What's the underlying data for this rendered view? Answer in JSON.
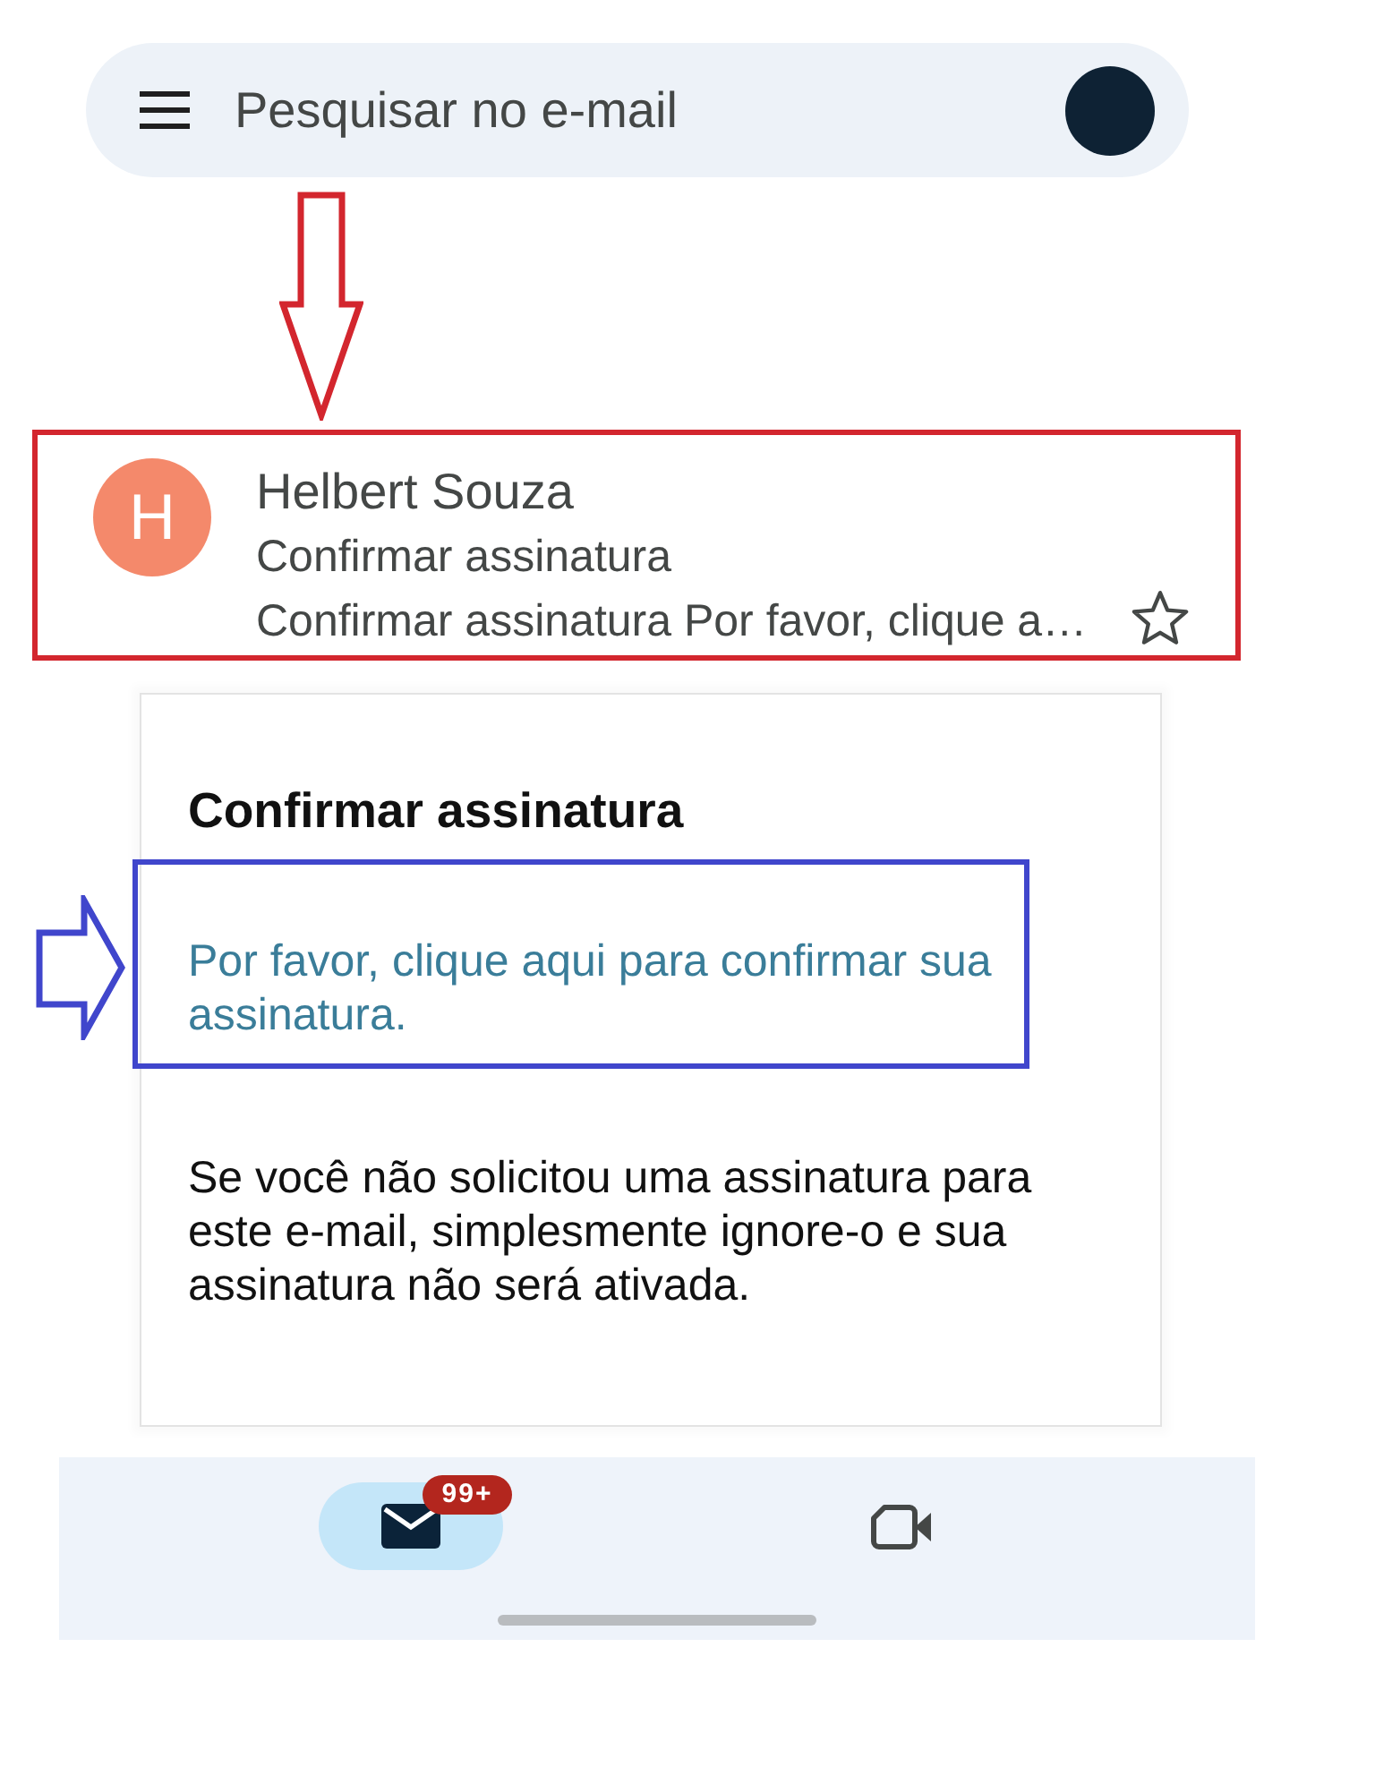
{
  "search_bar": {
    "placeholder": "Pesquisar no e-mail"
  },
  "email_row": {
    "avatar_letter": "H",
    "sender": "Helbert Souza",
    "subject": "Confirmar assinatura",
    "snippet": "Confirmar assinatura Por favor, clique a…",
    "starred": false,
    "highlight": {
      "kind": "down",
      "color": "#d3262e"
    }
  },
  "email_body": {
    "title": "Confirmar assinatura",
    "link": {
      "text": "Por favor, clique aqui para confirmar sua assinatura.",
      "highlight": {
        "kind": "right",
        "color": "#4046cc"
      }
    },
    "paragraph": "Se você não solicitou uma assinatura para este e-mail, simplesmente ignore-o e sua assinatura não será ativada."
  },
  "bottom_nav": {
    "items": [
      {
        "kind": "mail",
        "selected": true,
        "badge": "99+"
      },
      {
        "kind": "video",
        "selected": false
      }
    ]
  }
}
